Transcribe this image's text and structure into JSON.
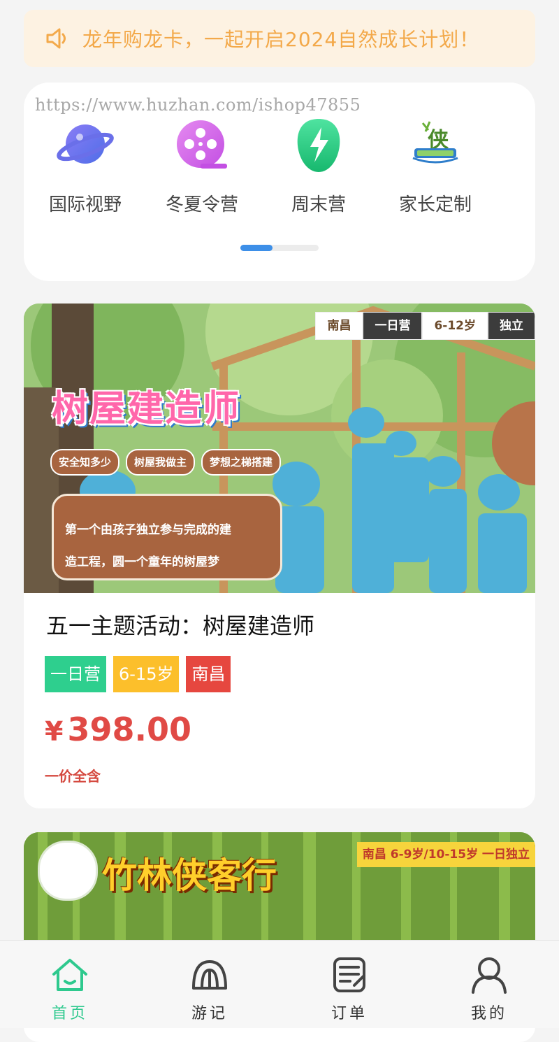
{
  "notice": {
    "text": "龙年购龙卡，一起开启2024自然成长计划！"
  },
  "watermark": "https://www.huzhan.com/ishop47855",
  "categories": [
    {
      "label": "国际视野",
      "icon": "planet-icon"
    },
    {
      "label": "冬夏令营",
      "icon": "film-reel-icon"
    },
    {
      "label": "周末营",
      "icon": "lightning-icon"
    },
    {
      "label": "家长定制",
      "icon": "camp-logo-icon"
    }
  ],
  "product": {
    "banner": {
      "tags": [
        "南昌",
        "一日营",
        "6-12岁",
        "独立"
      ],
      "title": "树屋建造师",
      "pills": [
        "安全知多少",
        "树屋我做主",
        "梦想之梯搭建"
      ],
      "desc_line1": "第一个由孩子独立参与完成的建",
      "desc_line2": "造工程，圆一个童年的树屋梦"
    },
    "title": "五一主题活动：树屋建造师",
    "tags": [
      "一日营",
      "6-15岁",
      "南昌"
    ],
    "currency": "¥",
    "price": "398.00",
    "price_note": "一价全含"
  },
  "product2": {
    "banner_title": "竹林侠客行",
    "banner_strip": "南昌  6-9岁/10-15岁  一日独立"
  },
  "tabs": [
    {
      "label": "首页",
      "active": true
    },
    {
      "label": "游记",
      "active": false
    },
    {
      "label": "订单",
      "active": false
    },
    {
      "label": "我的",
      "active": false
    }
  ],
  "colors": {
    "accent": "#2ec98e",
    "price": "#e04a45",
    "notice_text": "#f3a94a",
    "indicator": "#3d8fe8"
  }
}
